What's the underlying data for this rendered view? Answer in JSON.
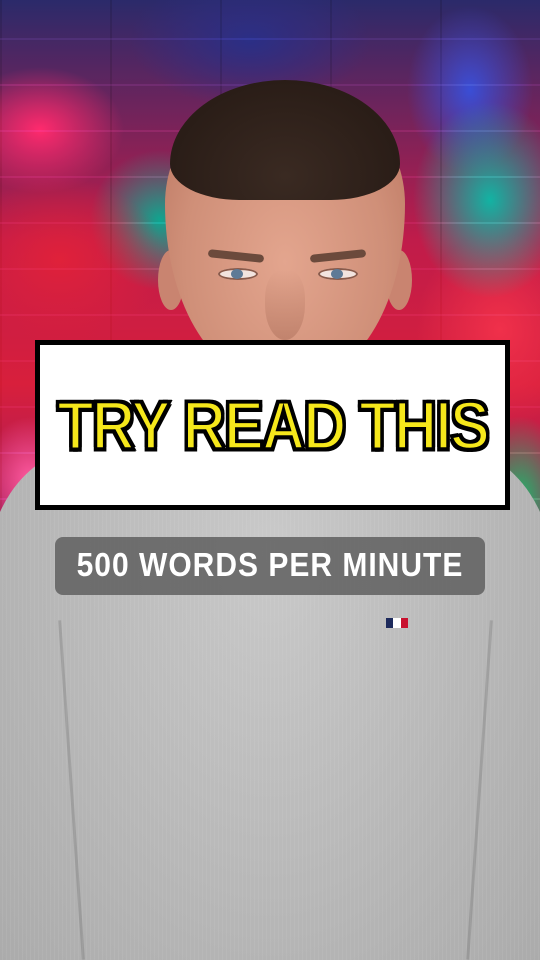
{
  "caption": {
    "headline": "TRY READ THIS"
  },
  "subtitle": {
    "text": "500 WORDS PER MINUTE"
  },
  "colors": {
    "headline_fill": "#f5e71b",
    "headline_outline": "#000000",
    "caption_box_bg": "#ffffff",
    "subtitle_bg": "#5f5f5f",
    "subtitle_text": "#ffffff"
  }
}
